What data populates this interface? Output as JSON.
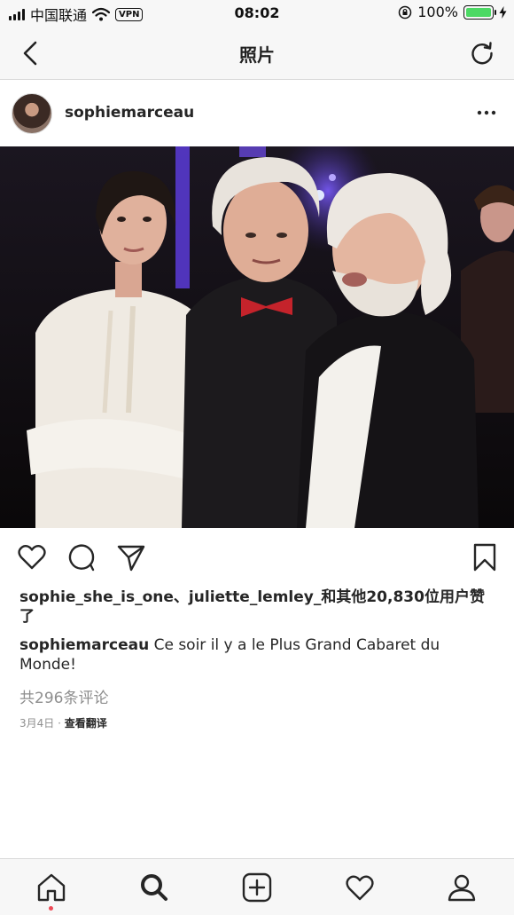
{
  "status_bar": {
    "carrier": "中国联通",
    "vpn": "VPN",
    "time": "08:02",
    "battery": "100%",
    "battery_level": 1.0,
    "battery_color": "#4cd964"
  },
  "nav": {
    "title": "照片",
    "back_icon": "chevron-left-icon",
    "refresh_icon": "refresh-icon"
  },
  "post": {
    "username": "sophiemarceau",
    "more_icon": "more-horizontal-icon",
    "photo_icon": "photo"
  },
  "actions": {
    "like_icon": "heart-icon",
    "comment_icon": "comment-icon",
    "share_icon": "send-icon",
    "save_icon": "bookmark-icon"
  },
  "likes_text": "sophie_she_is_one、juliette_lemley_和其他20,830位用户赞了",
  "caption": {
    "username": "sophiemarceau",
    "text": "Ce soir il y a le Plus Grand Cabaret du Monde!"
  },
  "comments_link": "共296条评论",
  "meta": {
    "date": "3月4日",
    "separator": " · ",
    "translate": "查看翻译"
  },
  "tab_bar": {
    "items": [
      "home-icon",
      "search-icon",
      "add-icon",
      "activity-icon",
      "profile-icon"
    ],
    "notification_color": "#ed4956"
  }
}
